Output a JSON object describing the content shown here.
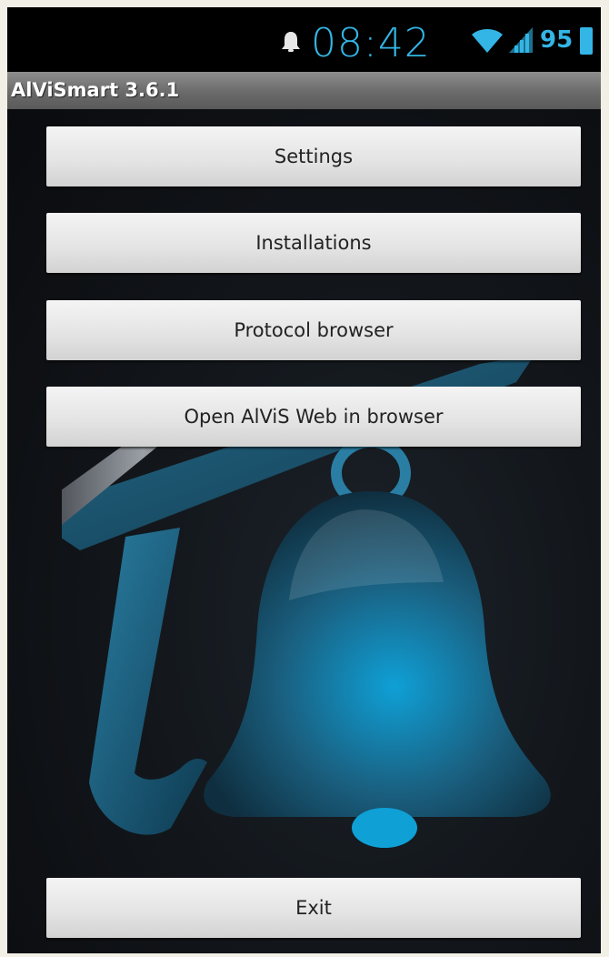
{
  "status_bar": {
    "time": "08:42",
    "battery": "95",
    "icons": [
      "bell-icon",
      "wifi-icon",
      "signal-icon",
      "battery-icon"
    ],
    "accent_color": "#33b5e5"
  },
  "title_bar": {
    "title": "AlViSmart 3.6.1"
  },
  "menu": {
    "settings_label": "Settings",
    "installations_label": "Installations",
    "protocol_label": "Protocol browser",
    "web_label": "Open AlViS Web in browser",
    "exit_label": "Exit"
  },
  "background": {
    "logo": "bell-logo"
  }
}
